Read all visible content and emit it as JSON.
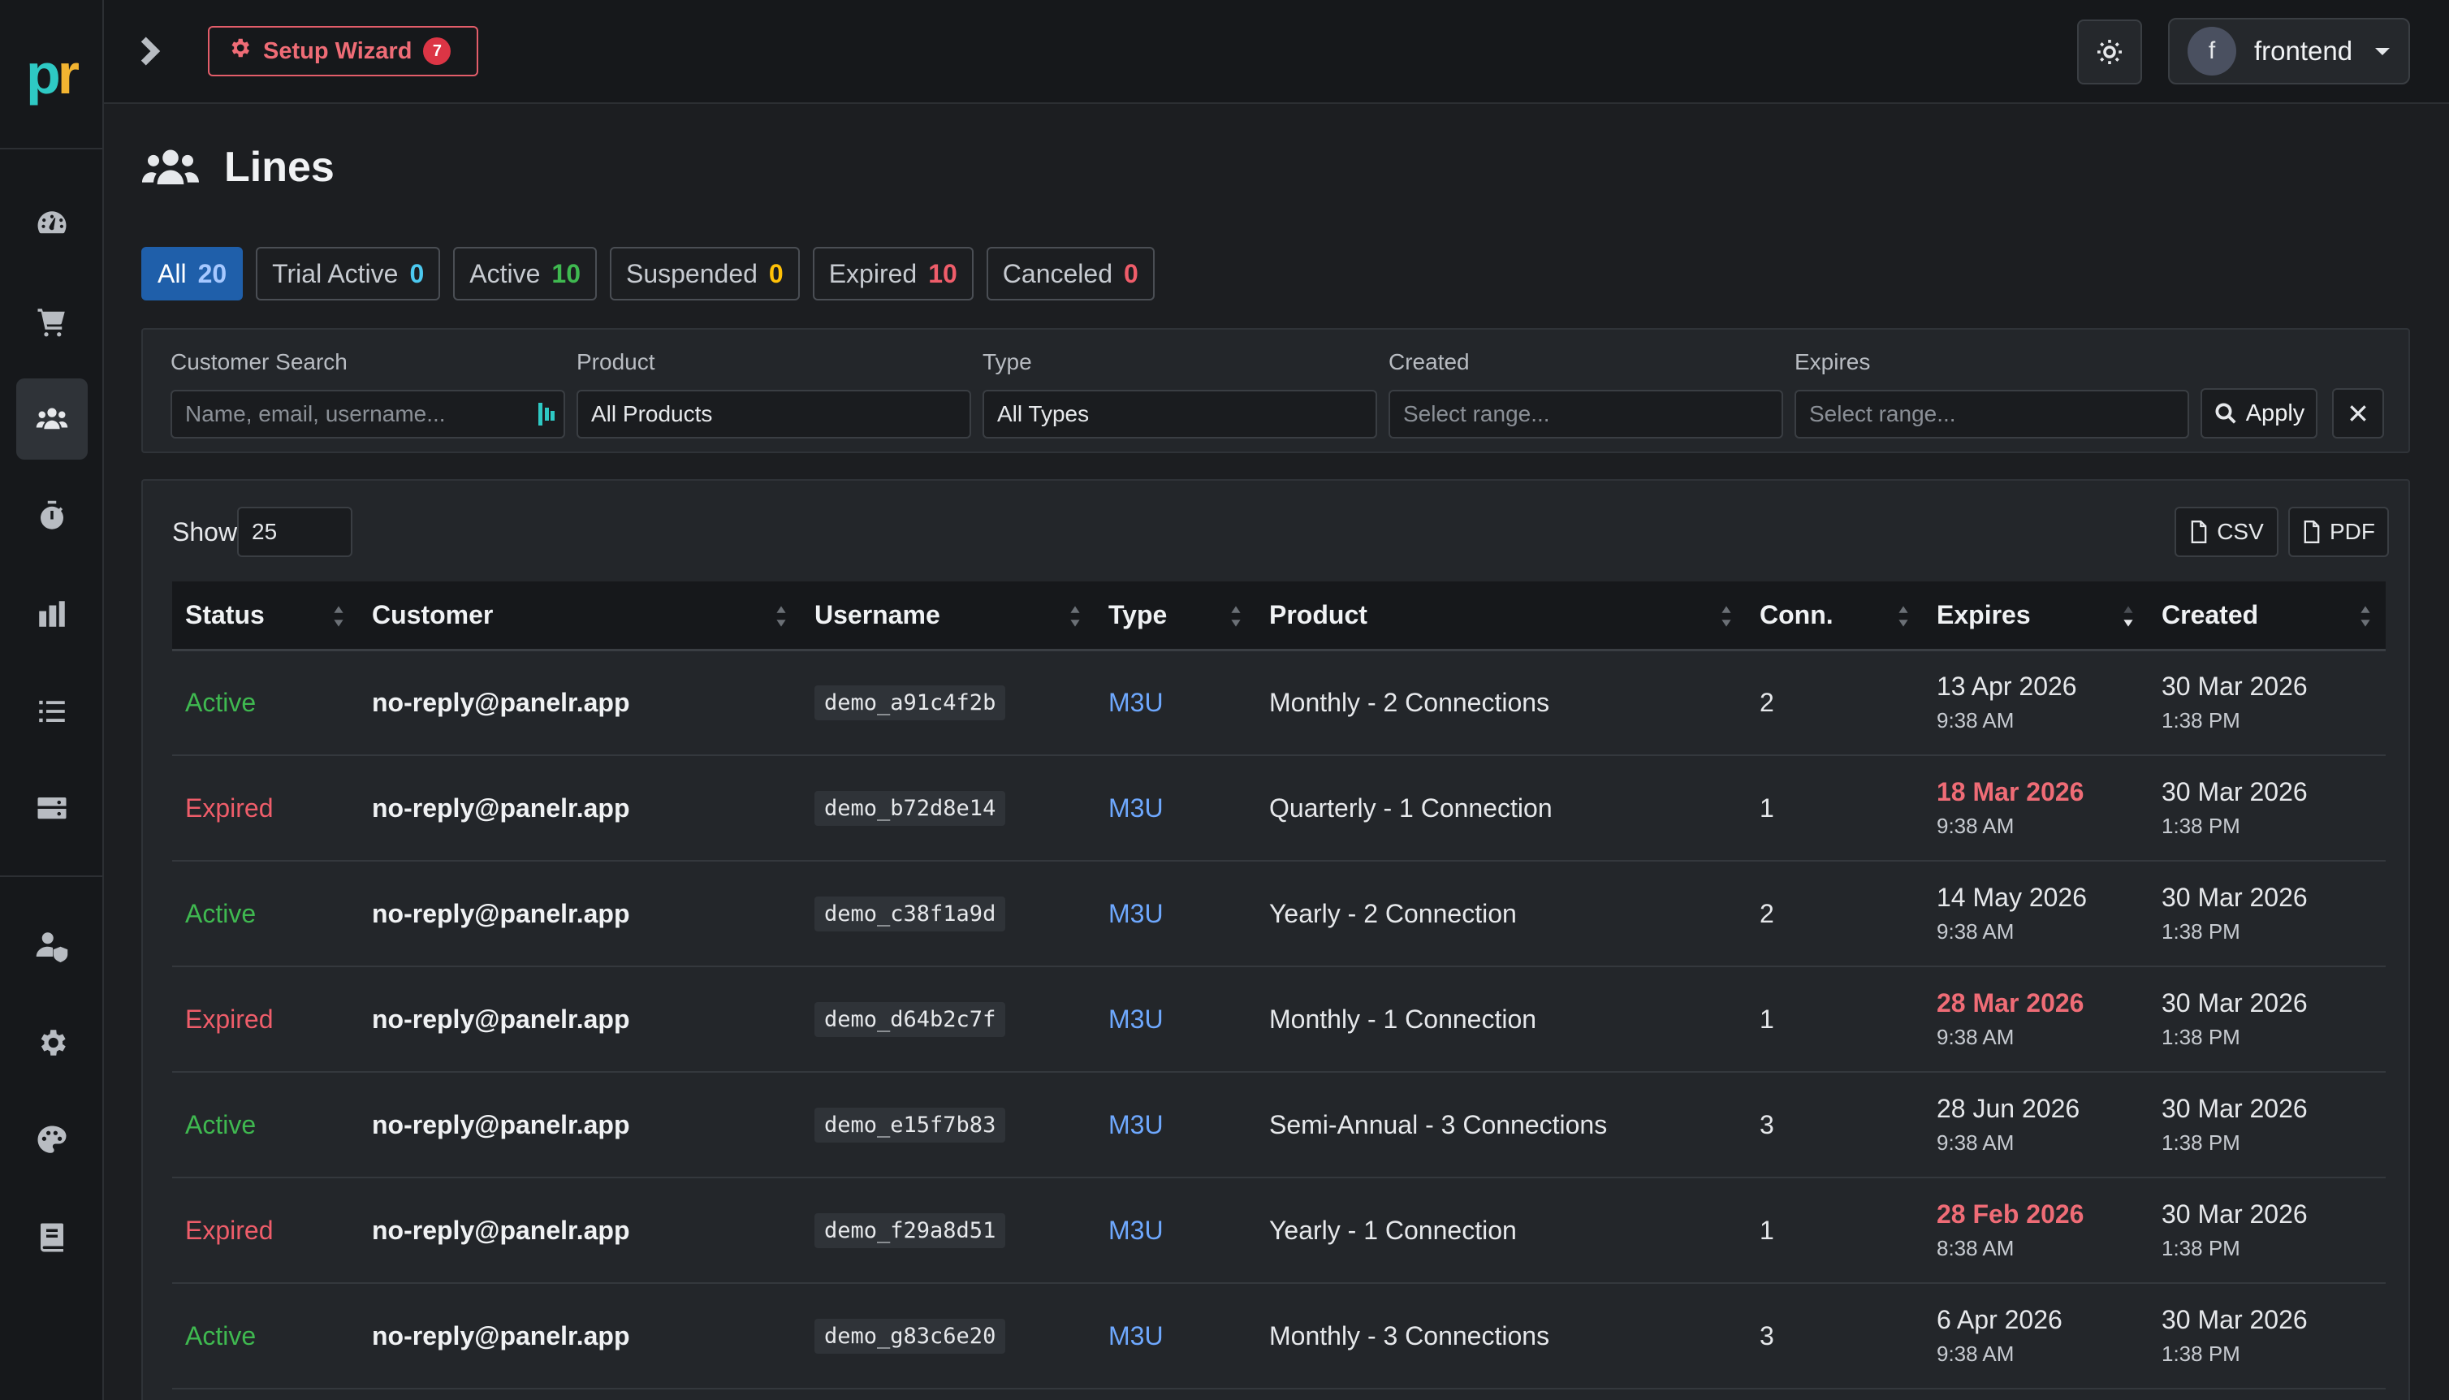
{
  "logo": {
    "p": "p",
    "r": "r"
  },
  "topbar": {
    "wizard_label": "Setup Wizard",
    "wizard_badge": "7",
    "user_initial": "f",
    "user_name": "frontend"
  },
  "page": {
    "title": "Lines"
  },
  "tabs": [
    {
      "label": "All",
      "count": "20",
      "count_color": "#a6c8ff"
    },
    {
      "label": "Trial Active",
      "count": "0",
      "count_color": "#4cc9f0"
    },
    {
      "label": "Active",
      "count": "10",
      "count_color": "#3fb950"
    },
    {
      "label": "Suspended",
      "count": "0",
      "count_color": "#ffc107"
    },
    {
      "label": "Expired",
      "count": "10",
      "count_color": "#ef5d6a"
    },
    {
      "label": "Canceled",
      "count": "0",
      "count_color": "#ef5d6a"
    }
  ],
  "filters": {
    "customer_label": "Customer Search",
    "customer_placeholder": "Name, email, username...",
    "product_label": "Product",
    "product_value": "All Products",
    "type_label": "Type",
    "type_value": "All Types",
    "created_label": "Created",
    "created_placeholder": "Select range...",
    "expires_label": "Expires",
    "expires_placeholder": "Select range...",
    "apply_label": "Apply"
  },
  "table_controls": {
    "show_label": "Show",
    "show_value": "25",
    "csv_label": "CSV",
    "pdf_label": "PDF"
  },
  "table": {
    "columns": [
      "Status",
      "Customer",
      "Username",
      "Type",
      "Product",
      "Conn.",
      "Expires",
      "Created"
    ],
    "rows": [
      {
        "status": "Active",
        "customer": "no-reply@panelr.app",
        "username": "demo_a91c4f2b",
        "type": "M3U",
        "product": "Monthly - 2 Connections",
        "conn": "2",
        "expires_date": "13 Apr 2026",
        "expires_time": "9:38 AM",
        "created_date": "30 Mar 2026",
        "created_time": "1:38 PM"
      },
      {
        "status": "Expired",
        "customer": "no-reply@panelr.app",
        "username": "demo_b72d8e14",
        "type": "M3U",
        "product": "Quarterly - 1 Connection",
        "conn": "1",
        "expires_date": "18 Mar 2026",
        "expires_time": "9:38 AM",
        "created_date": "30 Mar 2026",
        "created_time": "1:38 PM"
      },
      {
        "status": "Active",
        "customer": "no-reply@panelr.app",
        "username": "demo_c38f1a9d",
        "type": "M3U",
        "product": "Yearly - 2 Connection",
        "conn": "2",
        "expires_date": "14 May 2026",
        "expires_time": "9:38 AM",
        "created_date": "30 Mar 2026",
        "created_time": "1:38 PM"
      },
      {
        "status": "Expired",
        "customer": "no-reply@panelr.app",
        "username": "demo_d64b2c7f",
        "type": "M3U",
        "product": "Monthly - 1 Connection",
        "conn": "1",
        "expires_date": "28 Mar 2026",
        "expires_time": "9:38 AM",
        "created_date": "30 Mar 2026",
        "created_time": "1:38 PM"
      },
      {
        "status": "Active",
        "customer": "no-reply@panelr.app",
        "username": "demo_e15f7b83",
        "type": "M3U",
        "product": "Semi-Annual - 3 Connections",
        "conn": "3",
        "expires_date": "28 Jun 2026",
        "expires_time": "9:38 AM",
        "created_date": "30 Mar 2026",
        "created_time": "1:38 PM"
      },
      {
        "status": "Expired",
        "customer": "no-reply@panelr.app",
        "username": "demo_f29a8d51",
        "type": "M3U",
        "product": "Yearly - 1 Connection",
        "conn": "1",
        "expires_date": "28 Feb 2026",
        "expires_time": "8:38 AM",
        "created_date": "30 Mar 2026",
        "created_time": "1:38 PM"
      },
      {
        "status": "Active",
        "customer": "no-reply@panelr.app",
        "username": "demo_g83c6e20",
        "type": "M3U",
        "product": "Monthly - 3 Connections",
        "conn": "3",
        "expires_date": "6 Apr 2026",
        "expires_time": "9:38 AM",
        "created_date": "30 Mar 2026",
        "created_time": "1:38 PM"
      }
    ]
  },
  "icons": {
    "sidebar": [
      "dashboard-icon",
      "cart-icon",
      "users-icon",
      "stopwatch-icon",
      "reports-icon",
      "list-icon",
      "server-icon",
      "user-shield-icon",
      "gear-icon",
      "palette-icon",
      "book-icon"
    ]
  }
}
